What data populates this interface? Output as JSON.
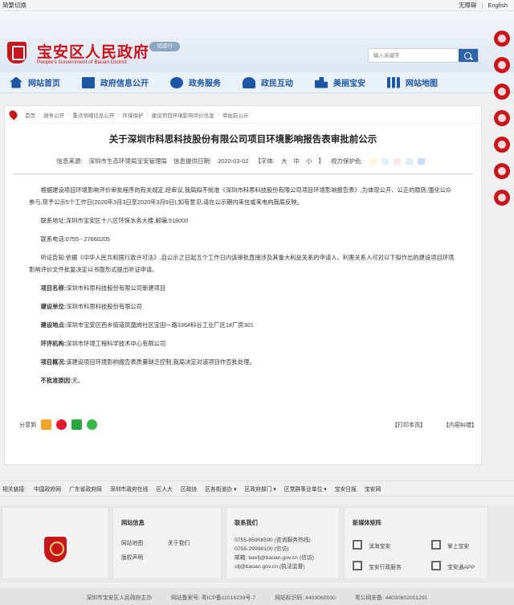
{
  "topbar": {
    "left": "简繁切换",
    "accessible": "无障碍",
    "sep": "|",
    "english": "English"
  },
  "header": {
    "title": "宝安区人民政府",
    "subtitle": "People's Government of Baoan District",
    "badge": "试运行",
    "search_placeholder": "输入关键字"
  },
  "nav": [
    "网站首页",
    "政府信息公开",
    "政务服务",
    "政民互动",
    "美丽宝安",
    "网站地图"
  ],
  "crumbs": [
    "首页",
    "政务公开",
    "重点领域信息公开",
    "环境保护",
    "建设项目环境影响评价信息",
    "审批前公示"
  ],
  "article": {
    "title": "关于深圳市科思科技股份有限公司项目环境影响报告表审批前公示",
    "source_label": "信息来源:",
    "source": "深圳市生态环境局宝安管理局",
    "date_label": "信息提供日期:",
    "date": "2020-03-02",
    "font_label": "【字体:",
    "font_sizes": [
      "大",
      "中",
      "小"
    ],
    "font_end": "】",
    "vision_label": "视力保护色:",
    "intro": "根据建设项目环境影响评价审批程序的有关规定,经审议,我局拟不批准《深圳市科思科技股份有限公司项目环境影响报告表》,为体现公开、公正的原则,强化公众参与,现予公示5个工作日(2020年3月3日至2020年3月9日),如有意见,请在公示期内来信或来电向我局反映。",
    "address": "联系地址:深圳市宝安区十八区环保水务大楼,邮编:518000",
    "phone": "联系电话:0755 - 27660205",
    "hearing": "听证告知:依据《中华人民共和国行政许可法》,自公示之日起五个工作日内该审批直接涉及其重大利益关系的申请人、利害关系人可对以下拟作出的建设项目环境影响评价文件批复决定以书面形式提出听证申请。",
    "fields": [
      {
        "label": "项目名称:",
        "value": "深圳市科思科技股份有限公司新建项目"
      },
      {
        "label": "建设单位:",
        "value": "深圳市科思科技股份有限公司"
      },
      {
        "label": "建设地点:",
        "value": "深圳市宝安区西乡街道凤凰岗社区宝田一路336#科谷工业厂区1#厂房301"
      },
      {
        "label": "环评机构:",
        "value": "深圳市环境工程科学技术中心有限公司"
      },
      {
        "label": "项目概况:",
        "value": "该建设项目环境影响报告表质量缺乏控制,我局决定对该项目作否批处理。"
      },
      {
        "label": "不批准原因:",
        "value": "无。"
      }
    ],
    "share_label": "分享到",
    "print": "【打印本页】",
    "correction": "【内容纠错】"
  },
  "links": [
    "相关链接:",
    "中国政府网",
    "广东省政府网",
    "深圳市政府在线",
    "区人大",
    "区政协",
    "区各街道办 ▾",
    "区政府部门 ▾",
    "区党群事业单位 ▾",
    "宝安日报",
    "宝安网"
  ],
  "footer": {
    "info_title": "网站信息",
    "info_links": [
      "网站地图",
      "关于我们",
      "版权声明"
    ],
    "contact_title": "联系我们",
    "contact": [
      "0755-85908590 (咨询服务热线)",
      "0755-29998100 (信访)",
      "邮箱: baxfj@baoan.gov.cn (信访)",
      "sfj@baoan.gov.cn (执法监督)"
    ],
    "media_title": "新媒体矩阵",
    "media": [
      "滨海宝安",
      "掌上宝安",
      "宝安行政服务",
      "宝安通APP"
    ],
    "bottom": [
      "深圳市宝安区人民政府主办",
      "网站备案号: 粤ICP备11016239号-7",
      "网站标识码: 4403060030",
      "粤公网安备: 44030602001291"
    ]
  },
  "colors": {
    "brand_red": "#c8161d",
    "nav_blue": "#1c56a5",
    "vision": [
      "#fdf6d6",
      "#e3f3fb",
      "#fde3ef",
      "#ddeefa",
      "#c9dcf5"
    ]
  }
}
